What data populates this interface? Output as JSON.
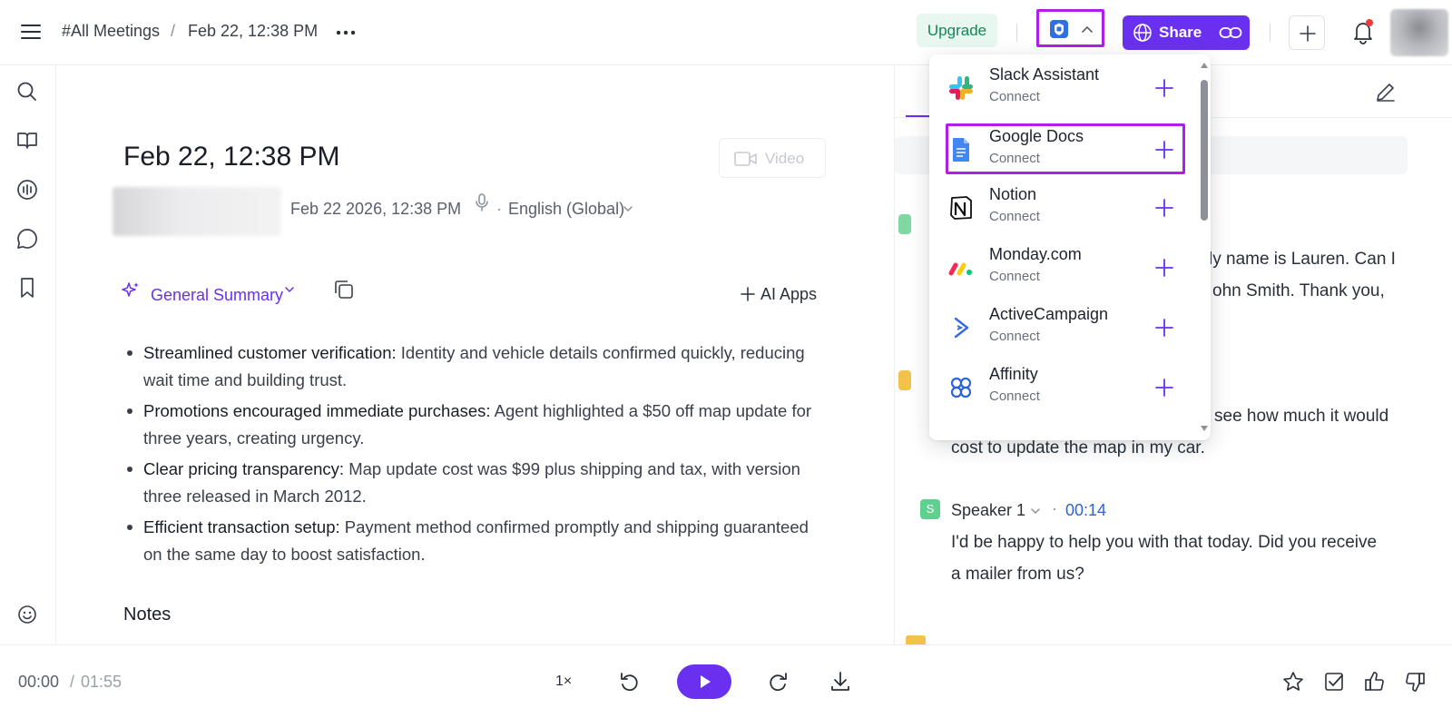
{
  "header": {
    "breadcrumb_root": "#All Meetings",
    "breadcrumb_sep": "/",
    "breadcrumb_current": "Feb 22, 12:38 PM",
    "upgrade_label": "Upgrade",
    "share_label": "Share"
  },
  "meeting": {
    "title": "Feb 22, 12:38 PM",
    "video_label": "Video",
    "datetime": "Feb 22 2026, 12:38 PM",
    "dot": "·",
    "language": "English (Global)"
  },
  "summary": {
    "label": "General Summary",
    "ai_apps_label": "AI Apps",
    "bullets": [
      {
        "lead": "Streamlined customer verification:",
        "rest": " Identity and vehicle details confirmed quickly, reducing wait time and building trust."
      },
      {
        "lead": "Promotions encouraged immediate purchases:",
        "rest": " Agent highlighted a $50 off map update for three years, creating urgency."
      },
      {
        "lead": "Clear pricing transparency:",
        "rest": " Map update cost was $99 plus shipping and tax, with version three released in March 2012."
      },
      {
        "lead": "Efficient transaction setup:",
        "rest": " Payment method confirmed promptly and shipping guaranteed on the same day to boost satisfaction."
      }
    ],
    "notes_label": "Notes"
  },
  "transcript": {
    "partial_line1": "ly name is Lauren. Can I",
    "partial_line2": "ohn Smith. Thank you,",
    "partial_line3": "see how much it would",
    "line4": "cost to update the map in my car.",
    "speaker_name": "Speaker 1",
    "speaker_initial": "S",
    "speaker_dot": "·",
    "speaker_time": "00:14",
    "speaker_text_1": "I'd be happy to help you with that today. Did you receive",
    "speaker_text_2": "a mailer from us?"
  },
  "integrations": {
    "items": [
      {
        "name": "Slack Assistant",
        "sub": "Connect",
        "icon": "slack-icon"
      },
      {
        "name": "Google Docs",
        "sub": "Connect",
        "icon": "google-docs-icon",
        "highlighted": true
      },
      {
        "name": "Notion",
        "sub": "Connect",
        "icon": "notion-icon"
      },
      {
        "name": "Monday.com",
        "sub": "Connect",
        "icon": "monday-icon"
      },
      {
        "name": "ActiveCampaign",
        "sub": "Connect",
        "icon": "activecampaign-icon"
      },
      {
        "name": "Affinity",
        "sub": "Connect",
        "icon": "affinity-icon"
      }
    ]
  },
  "player": {
    "current_time": "00:00",
    "separator": "/",
    "total_time": "01:55",
    "speed": "1×"
  },
  "colors": {
    "accent": "#6a30f0",
    "highlight": "#b01ee8",
    "upgrade_bg": "#e8f7ef",
    "upgrade_text": "#0e8a55",
    "time_link": "#2f63d6"
  }
}
